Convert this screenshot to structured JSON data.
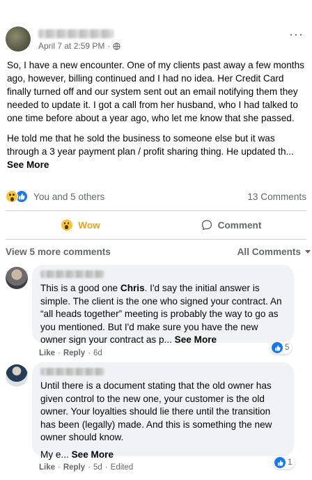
{
  "post": {
    "timestamp": "April 7 at 2:59 PM",
    "separator": "·",
    "more_glyph": "···",
    "paragraph1": "So, I have a new encounter. One of my clients past away a few months ago, however, billing continued and I had no idea. Her Credit Card finally turned off and our system sent out an email notifying them they needed to update it. I got a call from her husband, who I had talked to one time before about a year ago, who let me know that she passed.",
    "paragraph2_start": "He told me that he sold the business to someone else but it was through a 3 year payment plan / profit sharing thing. He updated th... ",
    "see_more": "See More"
  },
  "reactions": {
    "summary": "You and 5 others",
    "comments_count": "13 Comments",
    "icons": [
      "wow-icon",
      "like-icon"
    ]
  },
  "actions": {
    "wow_label": "Wow",
    "comment_label": "Comment"
  },
  "comments_header": {
    "view_more": "View 5 more comments",
    "filter": "All Comments"
  },
  "comments": [
    {
      "text_pre": "This is a good one ",
      "mention": "Chris",
      "text_post": ". I'd say the initial answer is simple. The client is the one who signed your contract. An “all heads together” meeting is probably the way to go as you mentioned. But I'd make sure you have the new owner sign your contract as p... ",
      "see_more": "See More",
      "like": "Like",
      "reply": "Reply",
      "time": "6d",
      "like_count": "5"
    },
    {
      "text_main": "Until there is a document stating that the old owner has given control to the new one, your customer is the old owner. Your loyalties should lie there until the transition has been (legally) made. And this is something the new owner should know.",
      "text_tail": "My e... ",
      "see_more": "See More",
      "like": "Like",
      "reply": "Reply",
      "time": "5d",
      "edited": "Edited",
      "like_count": "1"
    }
  ],
  "colors": {
    "facebook_blue": "#1877f2",
    "wow_yellow": "#f7c337",
    "wow_label": "#e8a317",
    "secondary_text": "#65676b",
    "bubble_bg": "#f0f2f5"
  }
}
